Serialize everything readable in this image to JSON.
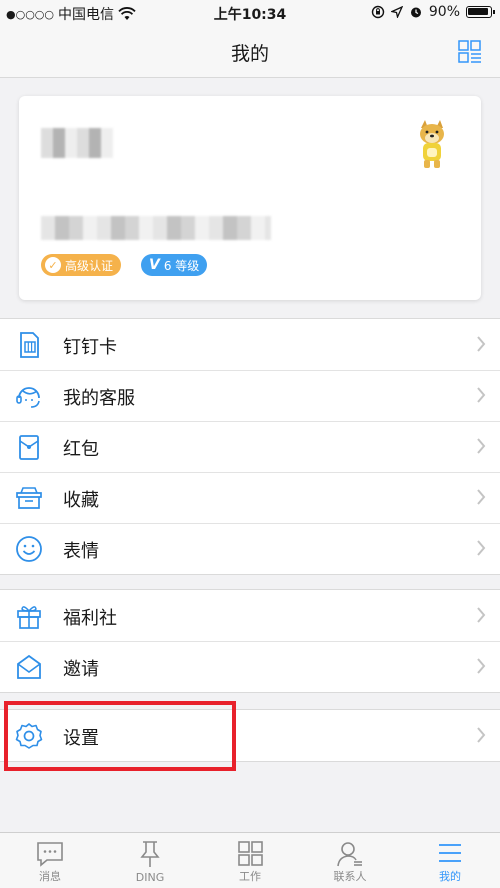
{
  "status_bar": {
    "signal_dots": "●○○○○",
    "carrier": "中国电信",
    "time": "上午10:34",
    "battery": "90%"
  },
  "header": {
    "title": "我的"
  },
  "profile": {
    "badges": {
      "certified": "高级认证",
      "level_mark": "V",
      "level": "6 等级"
    }
  },
  "menu": {
    "group1": [
      {
        "label": "钉钉卡",
        "icon": "sim-card-icon"
      },
      {
        "label": "我的客服",
        "icon": "customer-service-icon"
      },
      {
        "label": "红包",
        "icon": "red-envelope-icon"
      },
      {
        "label": "收藏",
        "icon": "favorites-box-icon"
      },
      {
        "label": "表情",
        "icon": "smiley-icon"
      }
    ],
    "group2": [
      {
        "label": "福利社",
        "icon": "gift-icon"
      },
      {
        "label": "邀请",
        "icon": "envelope-icon"
      }
    ],
    "group3": [
      {
        "label": "设置",
        "icon": "gear-icon"
      }
    ]
  },
  "tabs": [
    {
      "label": "消息",
      "icon": "chat-icon"
    },
    {
      "label": "DING",
      "icon": "pin-icon"
    },
    {
      "label": "工作",
      "icon": "grid-icon"
    },
    {
      "label": "联系人",
      "icon": "contacts-icon"
    },
    {
      "label": "我的",
      "icon": "menu-icon",
      "active": true
    }
  ],
  "colors": {
    "accent": "#3296fa",
    "icon_blue": "#2f8fe8",
    "highlight": "#e8212b",
    "badge_gold": "#f5b24b",
    "badge_blue": "#3fa0f0"
  }
}
